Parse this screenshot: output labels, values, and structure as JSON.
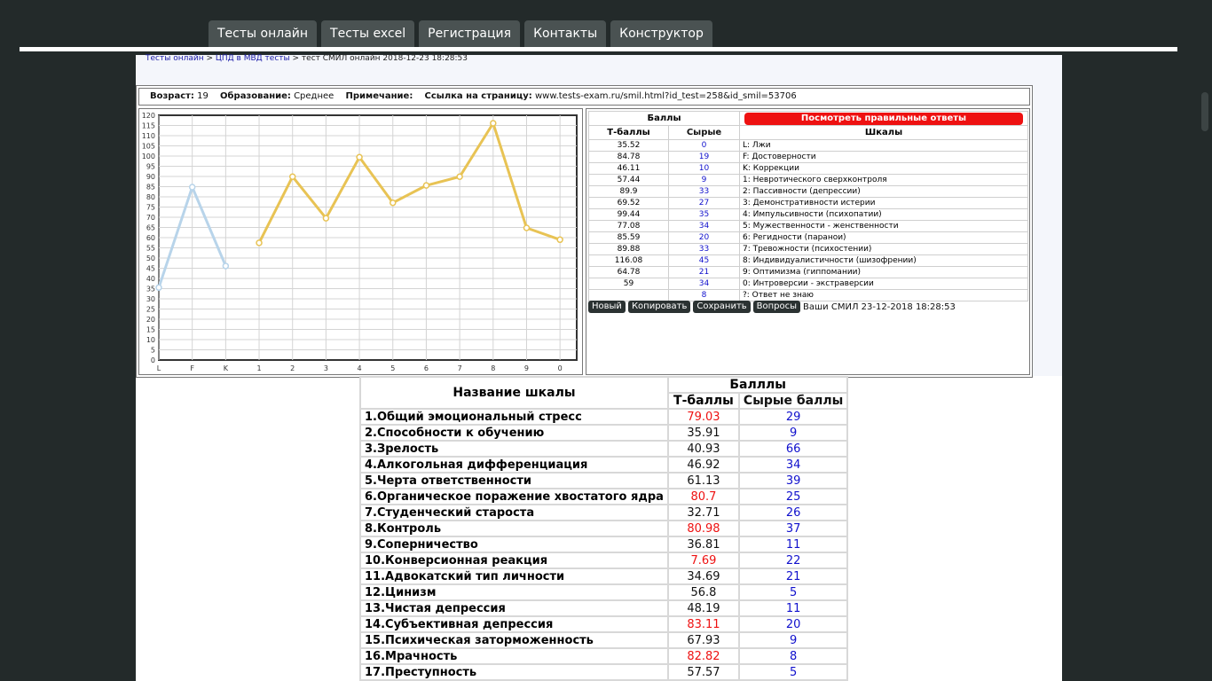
{
  "nav": {
    "tabs": [
      {
        "label": "Тесты онлайн"
      },
      {
        "label": "Тесты excel"
      },
      {
        "label": "Регистрация"
      },
      {
        "label": "Контакты"
      },
      {
        "label": "Конструктор"
      }
    ]
  },
  "breadcrumb": {
    "link1": "Тесты онлайн",
    "sep": ">",
    "link2": "ЦПД в МВД тесты",
    "current": "тест СМИЛ онлайн 2018-12-23 18:28:53"
  },
  "info": {
    "age_label": "Возраст:",
    "age_value": "19",
    "edu_label": "Образование:",
    "edu_value": "Среднее",
    "note_label": "Примечание:",
    "link_label": "Ссылка на страницу:",
    "link_value": "www.tests-exam.ru/smil.html?id_test=258&id_smil=53706"
  },
  "chart_data": {
    "type": "line",
    "categories": [
      "L",
      "F",
      "K",
      "1",
      "2",
      "3",
      "4",
      "5",
      "6",
      "7",
      "8",
      "9",
      "0"
    ],
    "series": [
      {
        "values": [
          35.52,
          84.78,
          46.11
        ],
        "color": "#b8d4ea"
      },
      {
        "values": [
          null,
          null,
          null,
          57.44,
          89.9,
          69.52,
          99.44,
          77.08,
          85.59,
          89.88,
          116.08,
          64.78,
          59
        ],
        "color": "#e8c354"
      }
    ],
    "ylim": [
      0,
      120
    ],
    "yticks": [
      "120",
      "115",
      "110",
      "105",
      "100",
      "95",
      "90",
      "85",
      "80",
      "75",
      "70",
      "65",
      "60",
      "55",
      "50",
      "45",
      "40",
      "35",
      "30",
      "25",
      "20",
      "15",
      "10",
      "5",
      "0"
    ],
    "grid": true
  },
  "scores": {
    "header_balls": "Баллы",
    "answers_button": "Посмотреть правильные ответы",
    "col_t": "Т-баллы",
    "col_raw": "Сырые",
    "col_scale": "Шкалы",
    "rows": [
      {
        "t": "35.52",
        "raw": "0",
        "scale": "L: Лжи"
      },
      {
        "t": "84.78",
        "raw": "19",
        "scale": "F: Достоверности"
      },
      {
        "t": "46.11",
        "raw": "10",
        "scale": "K: Коррекции"
      },
      {
        "t": "57.44",
        "raw": "9",
        "scale": "1: Невротического сверхконтроля"
      },
      {
        "t": "89.9",
        "raw": "33",
        "scale": "2: Пассивности (депрессии)"
      },
      {
        "t": "69.52",
        "raw": "27",
        "scale": "3: Демонстративности истерии"
      },
      {
        "t": "99.44",
        "raw": "35",
        "scale": "4: Импульсивности (психопатии)"
      },
      {
        "t": "77.08",
        "raw": "34",
        "scale": "5: Мужественности - женственности"
      },
      {
        "t": "85.59",
        "raw": "20",
        "scale": "6: Регидности (паранои)"
      },
      {
        "t": "89.88",
        "raw": "33",
        "scale": "7: Тревожности (психостении)"
      },
      {
        "t": "116.08",
        "raw": "45",
        "scale": "8: Индивидуалистичности (шизофрении)"
      },
      {
        "t": "64.78",
        "raw": "21",
        "scale": "9: Оптимизма (гиппомании)"
      },
      {
        "t": "59",
        "raw": "34",
        "scale": "0: Интроверсии - экстраверсии"
      },
      {
        "t": "",
        "raw": "8",
        "scale": "?: Ответ не знаю"
      }
    ],
    "buttons": {
      "new": "Новый",
      "copy": "Копировать",
      "save": "Сохранить",
      "questions": "Вопросы"
    },
    "note": "Ваши СМИЛ 23-12-2018 18:28:53"
  },
  "scales_table": {
    "col_name": "Название шкалы",
    "col_balls": "Балллы",
    "col_t": "Т-баллы",
    "col_raw": "Сырые баллы",
    "rows": [
      {
        "name": "1.Общий эмоциональный стресс",
        "t": "79.03",
        "raw": "29",
        "t_red": true
      },
      {
        "name": "2.Способности к обучению",
        "t": "35.91",
        "raw": "9",
        "t_red": false
      },
      {
        "name": "3.Зрелость",
        "t": "40.93",
        "raw": "66",
        "t_red": false
      },
      {
        "name": "4.Алкогольная дифференциация",
        "t": "46.92",
        "raw": "34",
        "t_red": false
      },
      {
        "name": "5.Черта ответственности",
        "t": "61.13",
        "raw": "39",
        "t_red": false
      },
      {
        "name": "6.Органическое поражение хвостатого ядра",
        "t": "80.7",
        "raw": "25",
        "t_red": true
      },
      {
        "name": "7.Студенческий староста",
        "t": "32.71",
        "raw": "26",
        "t_red": false
      },
      {
        "name": "8.Контроль",
        "t": "80.98",
        "raw": "37",
        "t_red": true
      },
      {
        "name": "9.Соперничество",
        "t": "36.81",
        "raw": "11",
        "t_red": false
      },
      {
        "name": "10.Конверсионная реакция",
        "t": "7.69",
        "raw": "22",
        "t_red": true
      },
      {
        "name": "11.Адвокатский тип личности",
        "t": "34.69",
        "raw": "21",
        "t_red": false
      },
      {
        "name": "12.Цинизм",
        "t": "56.8",
        "raw": "5",
        "t_red": false
      },
      {
        "name": "13.Чистая депрессия",
        "t": "48.19",
        "raw": "11",
        "t_red": false
      },
      {
        "name": "14.Субъективная депрессия",
        "t": "83.11",
        "raw": "20",
        "t_red": true
      },
      {
        "name": "15.Психическая заторможенность",
        "t": "67.93",
        "raw": "9",
        "t_red": false
      },
      {
        "name": "16.Мрачность",
        "t": "82.82",
        "raw": "8",
        "t_red": true
      },
      {
        "name": "17.Преступность",
        "t": "57.57",
        "raw": "5",
        "t_red": false
      }
    ]
  },
  "colors": {
    "red_value": "#ee1111",
    "blue_value": "#1010cc"
  }
}
